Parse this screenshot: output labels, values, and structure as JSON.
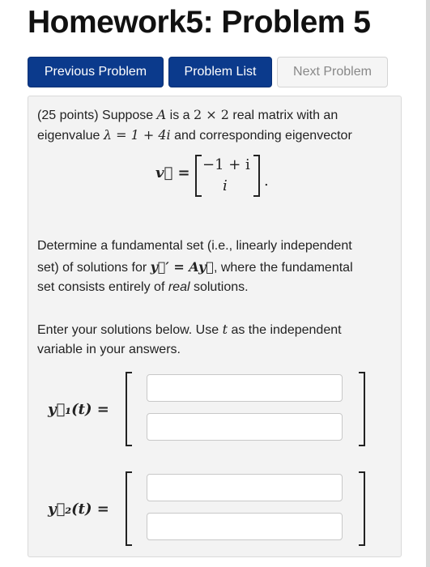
{
  "page": {
    "title": "Homework5: Problem 5"
  },
  "nav": {
    "previous_label": "Previous Problem",
    "list_label": "Problem List",
    "next_label": "Next Problem"
  },
  "problem": {
    "intro_1a": "(25 points) Suppose ",
    "matrix_A": "A",
    "intro_1b": " is a ",
    "dims": "2 × 2",
    "intro_1c": " real matrix with an",
    "intro_2a": "eigenvalue ",
    "eigenvalue": "λ = 1 + 4i",
    "intro_2b": " and corresponding eigenvector",
    "vector_lhs": "v⃗ =",
    "vector_top": "−1 + i",
    "vector_bottom": "i",
    "vector_end": ".",
    "task_1": "Determine a fundamental set (i.e., linearly independent",
    "task_2a": "set) of solutions for ",
    "ode": "y⃗′ = Ay⃗",
    "task_2b": ", where the fundamental",
    "task_3a": "set consists entirely of ",
    "task_3_real": "real",
    "task_3b": " solutions.",
    "enter_1a": "Enter your solutions below. Use ",
    "var_t": "t",
    "enter_1b": " as the independent",
    "enter_2": "variable in your answers.",
    "y1_label": "y⃗₁(t) =",
    "y2_label": "y⃗₂(t) ="
  },
  "answers": {
    "y1_top": "",
    "y1_bottom": "",
    "y2_top": "",
    "y2_bottom": ""
  }
}
